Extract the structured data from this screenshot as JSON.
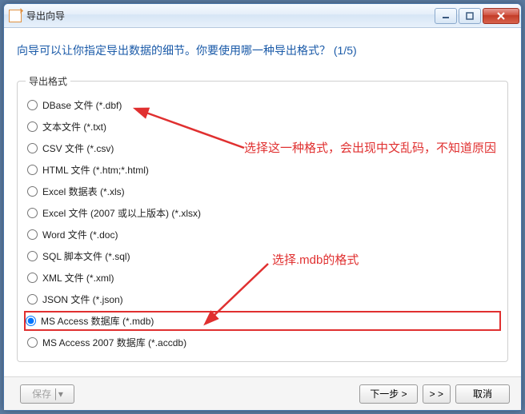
{
  "window": {
    "title": "导出向导"
  },
  "prompt": "向导可以让你指定导出数据的细节。你要使用哪一种导出格式？ (1/5)",
  "group_legend": "导出格式",
  "formats": [
    "DBase 文件 (*.dbf)",
    "文本文件 (*.txt)",
    "CSV 文件 (*.csv)",
    "HTML 文件 (*.htm;*.html)",
    "Excel 数据表 (*.xls)",
    "Excel 文件 (2007 或以上版本) (*.xlsx)",
    "Word 文件 (*.doc)",
    "SQL 脚本文件 (*.sql)",
    "XML 文件 (*.xml)",
    "JSON 文件 (*.json)",
    "MS Access 数据库 (*.mdb)",
    "MS Access 2007 数据库 (*.accdb)"
  ],
  "selected_index": 10,
  "highlight_index": 10,
  "footer": {
    "save": "保存",
    "next": "下一步 >",
    "skip": "> >",
    "cancel": "取消"
  },
  "annotations": {
    "line1": "选择这一种格式，会出现中文乱码，不知道原因",
    "line2": "选择.mdb的格式"
  },
  "colors": {
    "accent": "#1a5aa8",
    "annotation": "#e03030"
  }
}
